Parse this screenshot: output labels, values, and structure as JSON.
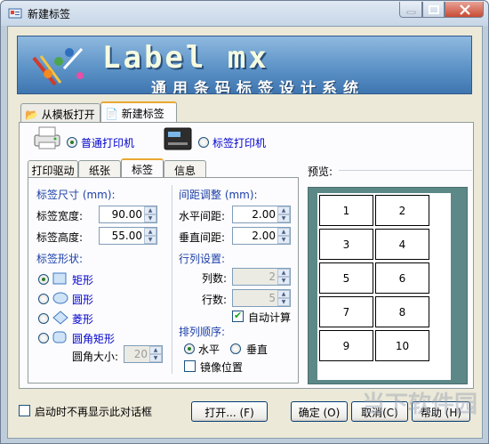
{
  "window": {
    "title": "新建标签"
  },
  "banner": {
    "logo_text": "Label mx",
    "subtitle": "通用条码标签设计系统"
  },
  "outer_tabs": [
    {
      "label": "从模板打开"
    },
    {
      "label": "新建标签"
    }
  ],
  "printer": {
    "normal_label": "普通打印机",
    "label_printer_label": "标签打印机",
    "selected": "normal"
  },
  "inner_tabs": [
    {
      "label": "打印驱动"
    },
    {
      "label": "纸张"
    },
    {
      "label": "标签"
    },
    {
      "label": "信息"
    }
  ],
  "label_size": {
    "title": "标签尺寸 (mm):",
    "width_label": "标签宽度:",
    "width_value": "90.00",
    "height_label": "标签高度:",
    "height_value": "55.00"
  },
  "shape": {
    "title": "标签形状:",
    "options": [
      "矩形",
      "圆形",
      "菱形",
      "圆角矩形"
    ],
    "selected": "矩形",
    "corner_label": "圆角大小:",
    "corner_value": "20"
  },
  "spacing": {
    "title": "间距调整 (mm):",
    "h_label": "水平间距:",
    "h_value": "2.00",
    "v_label": "垂直间距:",
    "v_value": "2.00"
  },
  "rows_cols": {
    "title": "行列设置:",
    "cols_label": "列数:",
    "cols_value": "2",
    "rows_label": "行数:",
    "rows_value": "5",
    "auto_label": "自动计算",
    "auto_checked": true
  },
  "order": {
    "title": "排列顺序:",
    "horizontal_label": "水平",
    "vertical_label": "垂直",
    "selected": "水平",
    "mirror_label": "镜像位置",
    "mirror_checked": false
  },
  "preview": {
    "title": "预览:",
    "cells": [
      "1",
      "2",
      "3",
      "4",
      "5",
      "6",
      "7",
      "8",
      "9",
      "10"
    ]
  },
  "footer": {
    "no_show_label": "启动时不再显示此对话框",
    "open_button": "打开... (F)",
    "ok_button": "确定 (O)",
    "cancel_button": "取消(C)",
    "help_button": "帮助 (H)"
  },
  "watermark": {
    "text": "当下软件园"
  },
  "colors": {
    "accent": "#1c3fa8",
    "banner": "#5d93c7",
    "preview_bg": "#5c8887"
  }
}
